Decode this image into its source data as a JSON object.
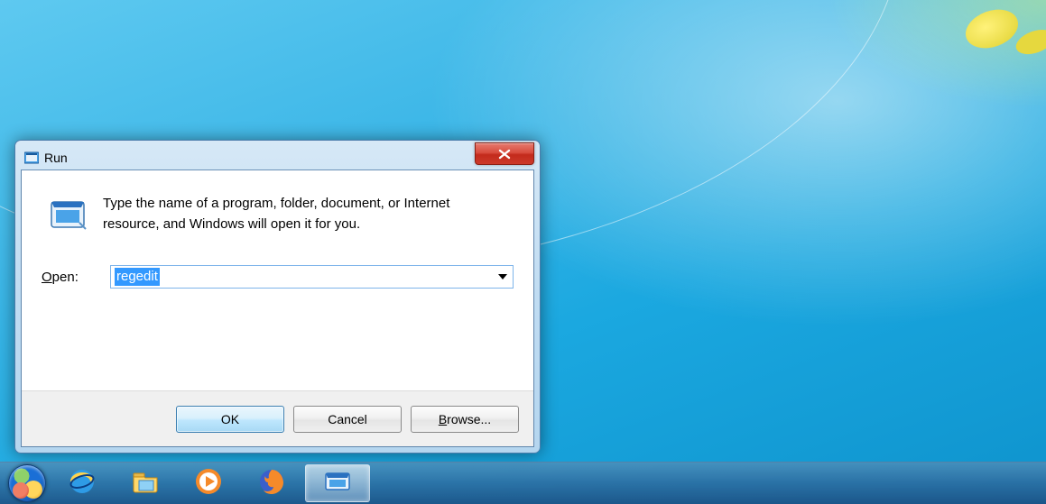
{
  "dialog": {
    "title": "Run",
    "description": "Type the name of a program, folder, document, or Internet resource, and Windows will open it for you.",
    "open_label_underlined_char": "O",
    "open_label_rest": "pen:",
    "combo_value": "regedit",
    "buttons": {
      "ok": "OK",
      "cancel": "Cancel",
      "browse_underlined_char": "B",
      "browse_rest": "rowse..."
    }
  },
  "taskbar": {
    "start": "Start",
    "items": [
      {
        "name": "internet-explorer"
      },
      {
        "name": "file-explorer"
      },
      {
        "name": "media-player"
      },
      {
        "name": "firefox"
      },
      {
        "name": "run-dialog",
        "active": true
      }
    ]
  }
}
